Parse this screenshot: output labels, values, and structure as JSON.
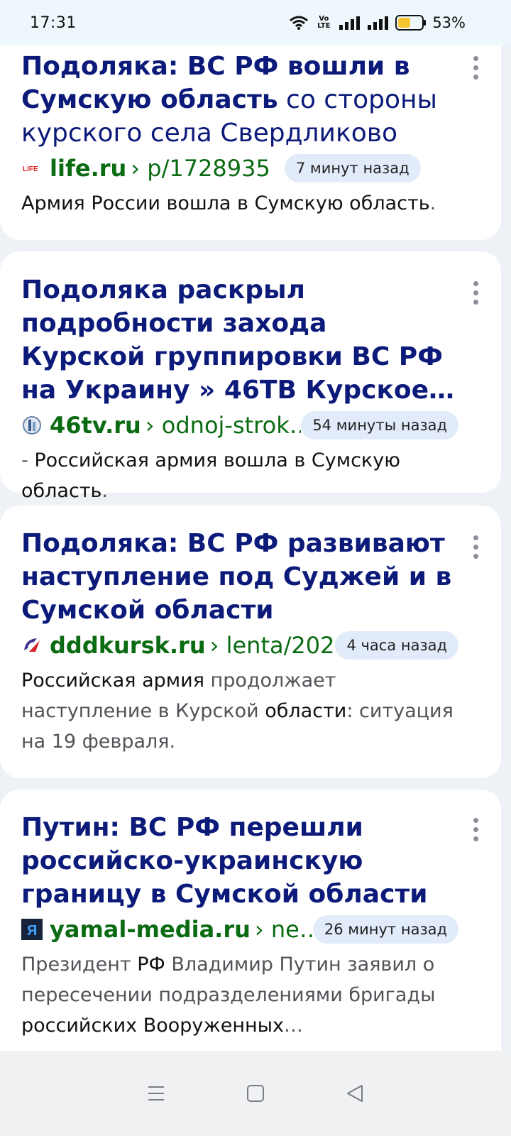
{
  "status_bar": {
    "time": "17:31",
    "volte": "Vo LTE",
    "battery_percent": "53%",
    "battery_level": 0.53,
    "battery_color": "#f7c531"
  },
  "results": [
    {
      "title_parts": [
        {
          "text": "Подоляка: ВС РФ вошли в Сумскую область",
          "bold": true
        },
        {
          "text": " со стороны курского села Свердликово",
          "bold": false
        }
      ],
      "favicon": "life-logo",
      "favicon_text": "LIFE",
      "domain": "life.ru",
      "path": "› p/1728935",
      "time": "7 минут назад",
      "snippet_parts": [
        {
          "text": "Армия России вошла в Сумскую область",
          "bold": true
        },
        {
          "text": ".",
          "bold": false
        }
      ]
    },
    {
      "title_parts": [
        {
          "text": "Подоляка раскрыл подробности захода Курской группировки ВС РФ на Украину » 46ТВ Курское…",
          "bold": true
        }
      ],
      "favicon": "46tv-logo",
      "favicon_text": "",
      "domain": "46tv.ru",
      "path": "› odnoj-strok…",
      "time": "54 минуты назад",
      "snippet_parts": [
        {
          "text": "- ",
          "bold": false
        },
        {
          "text": "Российская армия вошла в Сумскую область",
          "bold": true
        },
        {
          "text": ".",
          "bold": false
        }
      ]
    },
    {
      "title_parts": [
        {
          "text": "Подоляка: ВС РФ развивают наступление под Суджей и в Сумской области",
          "bold": true
        }
      ],
      "favicon": "dddkursk-logo",
      "favicon_text": "",
      "domain": "dddkursk.ru",
      "path": "› lenta/202…",
      "time": "4 часа назад",
      "snippet_parts": [
        {
          "text": "Российская армия",
          "bold": true
        },
        {
          "text": " продолжает наступление в Курской ",
          "bold": false
        },
        {
          "text": "области",
          "bold": true
        },
        {
          "text": ": ситуация на 19 февраля.",
          "bold": false
        }
      ]
    },
    {
      "title_parts": [
        {
          "text": "Путин: ВС РФ перешли российско-украинскую границу в Сумской области",
          "bold": true
        }
      ],
      "favicon": "yamal-media-logo",
      "favicon_text": "Я",
      "domain": "yamal-media.ru",
      "path": "› ne…",
      "time": "26 минут назад",
      "snippet_parts": [
        {
          "text": "Президент ",
          "bold": false
        },
        {
          "text": "РФ",
          "bold": true
        },
        {
          "text": " Владимир Путин заявил о пересечении подразделениями бригады ",
          "bold": false
        },
        {
          "text": "российских Вооруженных",
          "bold": true
        },
        {
          "text": "…",
          "bold": false
        }
      ]
    }
  ],
  "nav_bar": {
    "items": [
      "menu-icon",
      "home-icon",
      "back-icon"
    ]
  }
}
